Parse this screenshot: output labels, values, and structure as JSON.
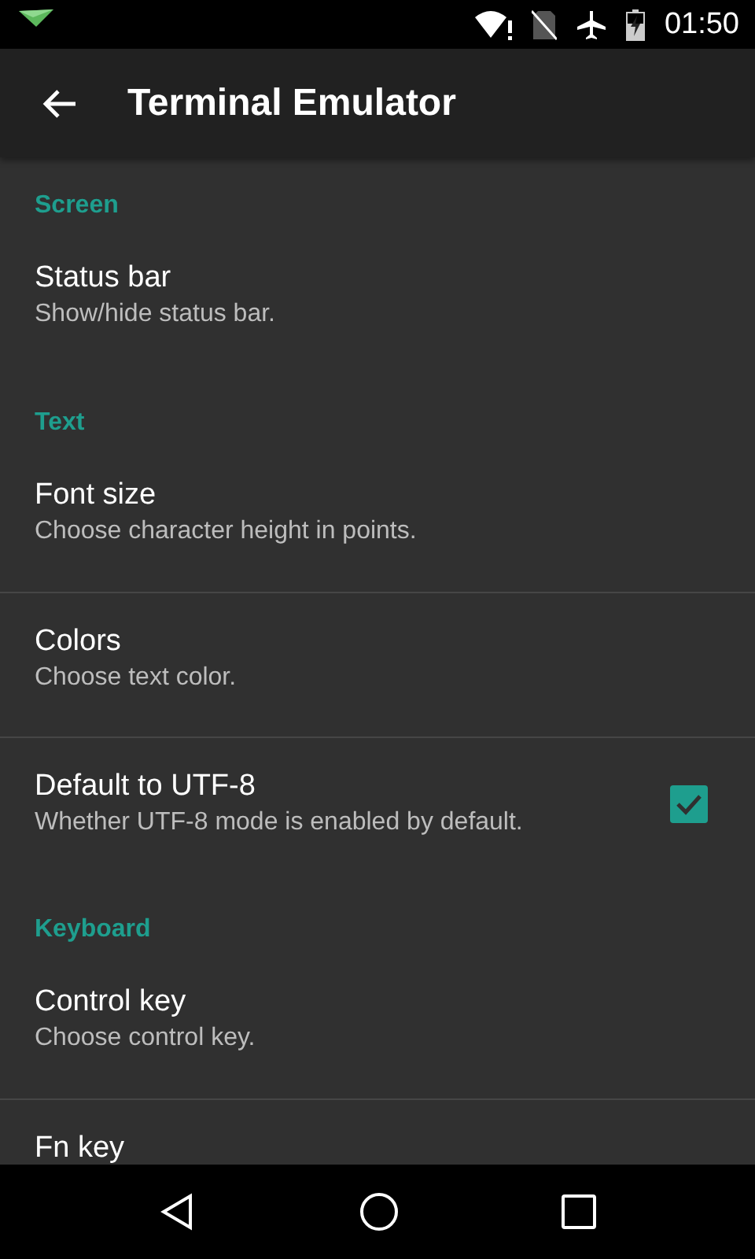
{
  "status_bar": {
    "time": "01:50"
  },
  "app_bar": {
    "title": "Terminal Emulator"
  },
  "sections": [
    {
      "header": "Screen",
      "items": [
        {
          "kind": "plain",
          "title": "Status bar",
          "summary": "Show/hide status bar."
        }
      ]
    },
    {
      "header": "Text",
      "items": [
        {
          "kind": "plain",
          "title": "Font size",
          "summary": "Choose character height in points."
        },
        {
          "kind": "plain",
          "title": "Colors",
          "summary": "Choose text color."
        },
        {
          "kind": "checkbox",
          "title": "Default to UTF-8",
          "summary": "Whether UTF-8 mode is enabled by default.",
          "checked": true
        }
      ]
    },
    {
      "header": "Keyboard",
      "items": [
        {
          "kind": "plain",
          "title": "Control key",
          "summary": "Choose control key."
        },
        {
          "kind": "plain",
          "title": "Fn key"
        }
      ]
    }
  ]
}
